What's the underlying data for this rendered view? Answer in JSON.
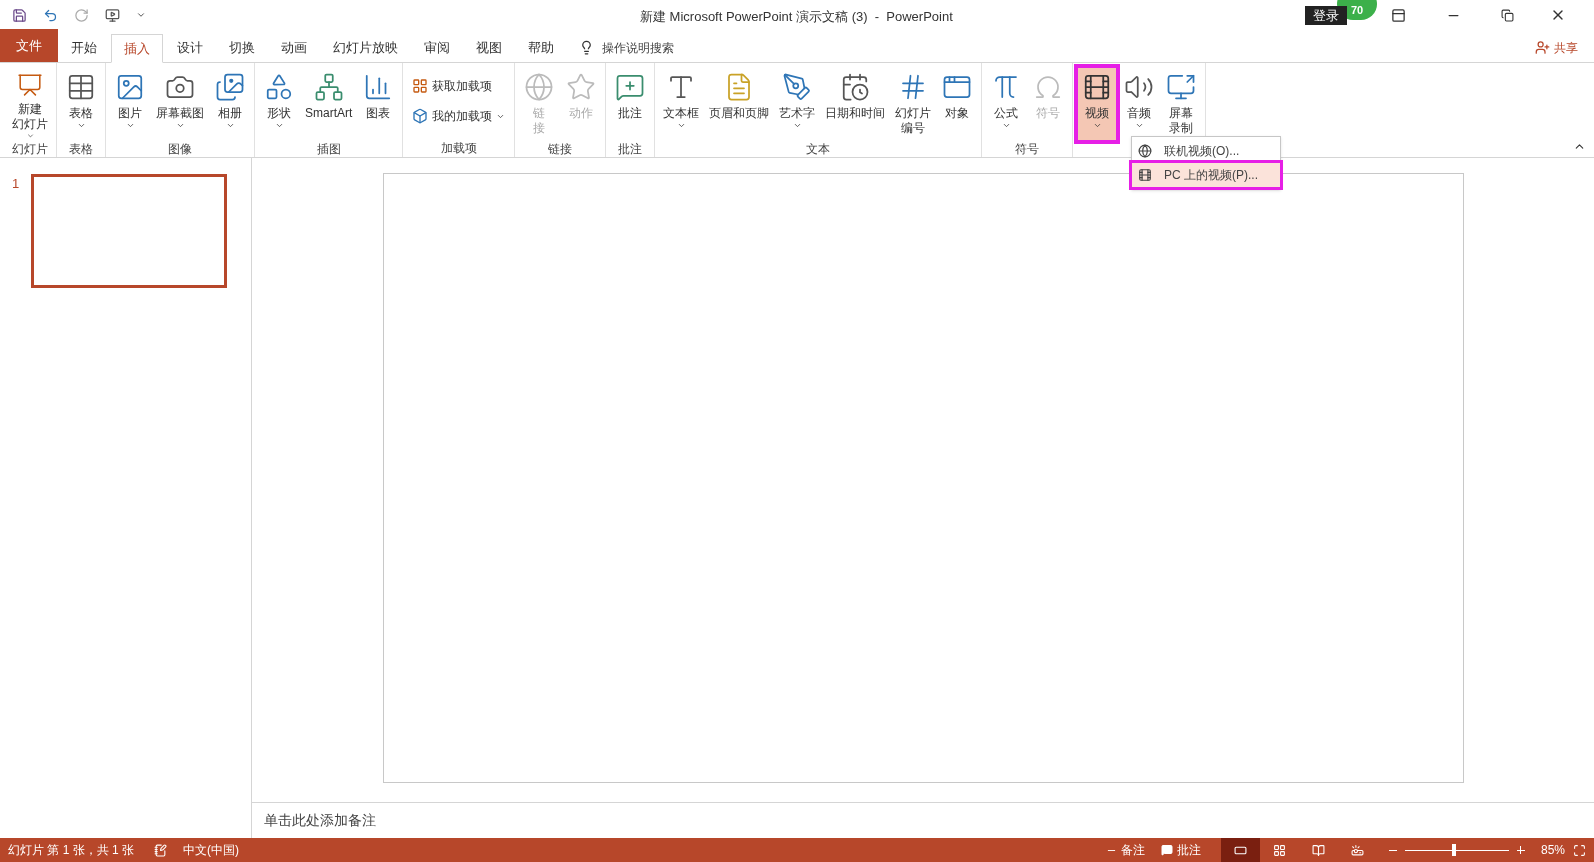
{
  "window": {
    "title": "新建 Microsoft PowerPoint 演示文稿 (3)  -  PowerPoint",
    "badge": "70",
    "login": "登录",
    "share": "共享"
  },
  "tabs": [
    {
      "label": "文件",
      "kind": "file",
      "selected": false
    },
    {
      "label": "开始",
      "kind": "tab",
      "selected": false
    },
    {
      "label": "插入",
      "kind": "tab",
      "selected": true
    },
    {
      "label": "设计",
      "kind": "tab",
      "selected": false
    },
    {
      "label": "切换",
      "kind": "tab",
      "selected": false
    },
    {
      "label": "动画",
      "kind": "tab",
      "selected": false
    },
    {
      "label": "幻灯片放映",
      "kind": "tab",
      "selected": false
    },
    {
      "label": "审阅",
      "kind": "tab",
      "selected": false
    },
    {
      "label": "视图",
      "kind": "tab",
      "selected": false
    },
    {
      "label": "帮助",
      "kind": "tab",
      "selected": false
    }
  ],
  "search": {
    "placeholder": "操作说明搜索"
  },
  "ribbon": [
    {
      "label": "幻灯片",
      "items": [
        {
          "lines": [
            "新建",
            "幻灯片"
          ],
          "kind": "large",
          "dropdown": true,
          "disabled": false,
          "pressed": false,
          "highlighted": false
        }
      ]
    },
    {
      "label": "表格",
      "items": [
        {
          "label": "表格",
          "kind": "large",
          "dropdown": true,
          "disabled": false,
          "pressed": false,
          "highlighted": false
        }
      ]
    },
    {
      "label": "图像",
      "items": [
        {
          "label": "图片",
          "kind": "large",
          "dropdown": true,
          "disabled": false,
          "pressed": false,
          "highlighted": false
        },
        {
          "label": "屏幕截图",
          "kind": "large",
          "dropdown": true,
          "disabled": false,
          "pressed": false,
          "highlighted": false
        },
        {
          "label": "相册",
          "kind": "large",
          "dropdown": true,
          "disabled": false,
          "pressed": false,
          "highlighted": false
        }
      ]
    },
    {
      "label": "插图",
      "items": [
        {
          "label": "形状",
          "kind": "large",
          "dropdown": true,
          "disabled": false,
          "pressed": false,
          "highlighted": false
        },
        {
          "label": "SmartArt",
          "kind": "large",
          "dropdown": false,
          "disabled": false,
          "pressed": false,
          "highlighted": false
        },
        {
          "label": "图表",
          "kind": "large",
          "dropdown": false,
          "disabled": false,
          "pressed": false,
          "highlighted": false
        }
      ]
    },
    {
      "label": "加载项",
      "items": [
        {
          "label": "获取加载项",
          "kind": "small",
          "dropdown": false,
          "disabled": false,
          "pressed": false,
          "highlighted": false
        },
        {
          "label": "我的加载项",
          "kind": "small",
          "dropdown": true,
          "disabled": false,
          "pressed": false,
          "highlighted": false
        }
      ]
    },
    {
      "label": "链接",
      "items": [
        {
          "lines": [
            "链",
            "接"
          ],
          "kind": "large",
          "dropdown": false,
          "disabled": true,
          "pressed": false,
          "highlighted": false
        },
        {
          "label": "动作",
          "kind": "large",
          "dropdown": false,
          "disabled": true,
          "pressed": false,
          "highlighted": false
        }
      ]
    },
    {
      "label": "批注",
      "items": [
        {
          "label": "批注",
          "kind": "large",
          "dropdown": false,
          "disabled": false,
          "pressed": false,
          "highlighted": false
        }
      ]
    },
    {
      "label": "文本",
      "items": [
        {
          "label": "文本框",
          "kind": "large",
          "dropdown": true,
          "disabled": false,
          "pressed": false,
          "highlighted": false
        },
        {
          "label": "页眉和页脚",
          "kind": "large",
          "dropdown": false,
          "disabled": false,
          "pressed": false,
          "highlighted": false
        },
        {
          "label": "艺术字",
          "kind": "large",
          "dropdown": true,
          "disabled": false,
          "pressed": false,
          "highlighted": false
        },
        {
          "label": "日期和时间",
          "kind": "large",
          "dropdown": false,
          "disabled": false,
          "pressed": false,
          "highlighted": false
        },
        {
          "lines": [
            "幻灯片",
            "编号"
          ],
          "kind": "large",
          "dropdown": false,
          "disabled": false,
          "pressed": false,
          "highlighted": false
        },
        {
          "label": "对象",
          "kind": "large",
          "dropdown": false,
          "disabled": false,
          "pressed": false,
          "highlighted": false
        }
      ]
    },
    {
      "label": "符号",
      "items": [
        {
          "label": "公式",
          "kind": "large",
          "dropdown": true,
          "disabled": false,
          "pressed": false,
          "highlighted": false
        },
        {
          "label": "符号",
          "kind": "large",
          "dropdown": false,
          "disabled": true,
          "pressed": false,
          "highlighted": false
        }
      ]
    },
    {
      "items": [
        {
          "label": "视频",
          "kind": "large",
          "dropdown": true,
          "disabled": false,
          "pressed": true,
          "highlighted": true
        },
        {
          "label": "音频",
          "kind": "large",
          "dropdown": true,
          "disabled": false,
          "pressed": false,
          "highlighted": false
        },
        {
          "lines": [
            "屏幕",
            "录制"
          ],
          "kind": "large",
          "dropdown": false,
          "disabled": false,
          "pressed": false,
          "highlighted": false
        }
      ]
    }
  ],
  "video_menu": [
    {
      "label": "联机视频(O)...",
      "selected": false,
      "highlighted": false
    },
    {
      "label": "PC 上的视频(P)...",
      "selected": true,
      "highlighted": true
    }
  ],
  "slides": [
    {
      "number": "1",
      "selected": true
    }
  ],
  "notes": {
    "placeholder": "单击此处添加备注"
  },
  "status_bar": {
    "slide_info": "幻灯片 第 1 张，共 1 张",
    "language": "中文(中国)",
    "notes": "备注",
    "comments": "批注",
    "views": [
      {
        "selected": true
      },
      {
        "selected": false
      },
      {
        "selected": false
      },
      {
        "selected": false
      }
    ],
    "zoom": {
      "level": 0.45,
      "reading": "85%"
    }
  }
}
